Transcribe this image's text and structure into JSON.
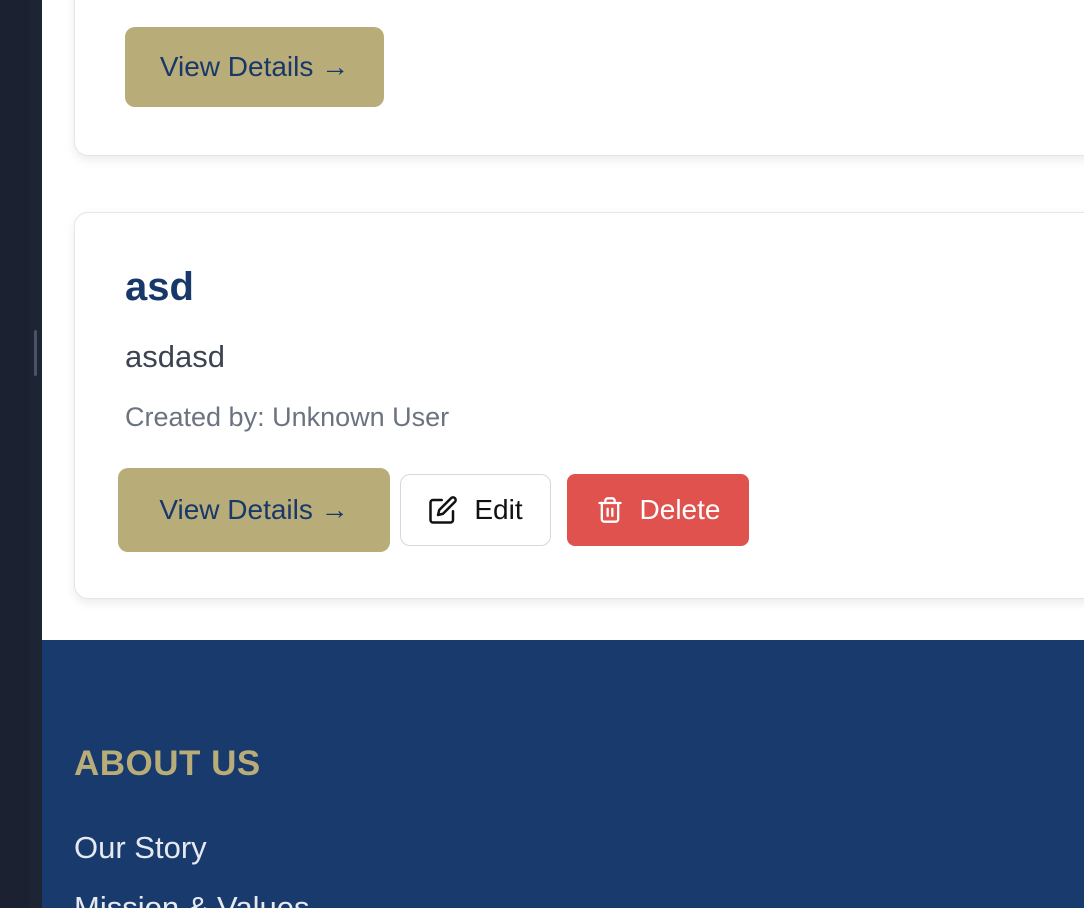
{
  "cards": [
    {
      "view_label": "View Details →"
    },
    {
      "title": "asd",
      "description": "asdasd",
      "meta": "Created by: Unknown User",
      "view_label": "View Details →",
      "edit_label": "Edit",
      "delete_label": "Delete"
    }
  ],
  "footer": {
    "heading": "ABOUT US",
    "links": [
      "Our Story",
      "Mission & Values"
    ]
  },
  "colors": {
    "primary_navy": "#19386a",
    "accent_gold": "#b8ac79",
    "danger_red": "#df524e"
  },
  "icons": {
    "edit": "edit-icon",
    "delete": "trash-icon"
  }
}
